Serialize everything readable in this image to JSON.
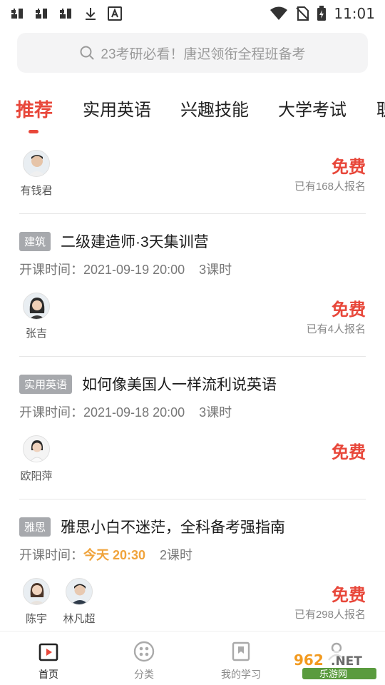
{
  "status_bar": {
    "time": "11:01",
    "left_icons": [
      "bug-icon",
      "bug-icon",
      "bug-icon",
      "download-icon",
      "font-icon"
    ],
    "right_icons": [
      "wifi-icon",
      "no-sim-icon",
      "battery-charging-icon"
    ]
  },
  "search": {
    "placeholder": "23考研必看！唐迟领衔全程班备考"
  },
  "tabs": [
    {
      "label": "推荐",
      "active": true
    },
    {
      "label": "实用英语"
    },
    {
      "label": "兴趣技能"
    },
    {
      "label": "大学考试"
    },
    {
      "label": "职"
    }
  ],
  "courses": [
    {
      "teachers": [
        {
          "name": "有钱君"
        }
      ],
      "price": "免费",
      "enrolled": "已有168人报名"
    },
    {
      "tag": "建筑",
      "title": "二级建造师·3天集训营",
      "time_label": "开课时间：",
      "time": "2021-09-19 20:00",
      "hours": "3课时",
      "teachers": [
        {
          "name": "张吉"
        }
      ],
      "price": "免费",
      "enrolled": "已有4人报名"
    },
    {
      "tag": "实用英语",
      "title": "如何像美国人一样流利说英语",
      "time_label": "开课时间：",
      "time": "2021-09-18 20:00",
      "hours": "3课时",
      "teachers": [
        {
          "name": "欧阳萍"
        }
      ],
      "price": "免费",
      "enrolled": ""
    },
    {
      "tag": "雅思",
      "title": "雅思小白不迷茫，全科备考强指南",
      "time_label": "开课时间：",
      "time": "今天 20:30",
      "hours": "2课时",
      "teachers": [
        {
          "name": "陈宇"
        },
        {
          "name": "林凡超"
        }
      ],
      "price": "免费",
      "enrolled": "已有298人报名"
    }
  ],
  "bottom_nav": [
    {
      "label": "首页",
      "icon": "home-play-icon",
      "active": true
    },
    {
      "label": "分类",
      "icon": "category-icon"
    },
    {
      "label": "我的学习",
      "icon": "bookmark-icon"
    }
  ],
  "watermark": {
    "text_top": "962.NET",
    "text_bottom": "乐游网"
  },
  "colors": {
    "accent": "#e8473a",
    "today": "#f0a33b",
    "tag_bg": "#a7a9ad"
  }
}
